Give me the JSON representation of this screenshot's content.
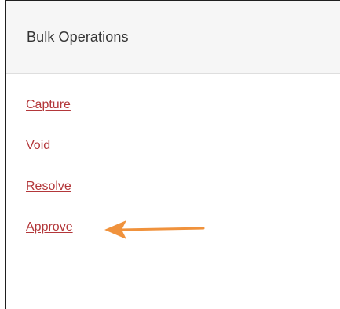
{
  "panel": {
    "title": "Bulk Operations",
    "links": [
      {
        "label": "Capture"
      },
      {
        "label": "Void"
      },
      {
        "label": "Resolve"
      },
      {
        "label": "Approve"
      }
    ]
  },
  "annotation": {
    "arrow_icon": "left-arrow-icon",
    "arrow_color": "#f0923c",
    "points_to": "Approve"
  },
  "colors": {
    "link": "#b3373a",
    "header_bg": "#f6f6f6"
  }
}
